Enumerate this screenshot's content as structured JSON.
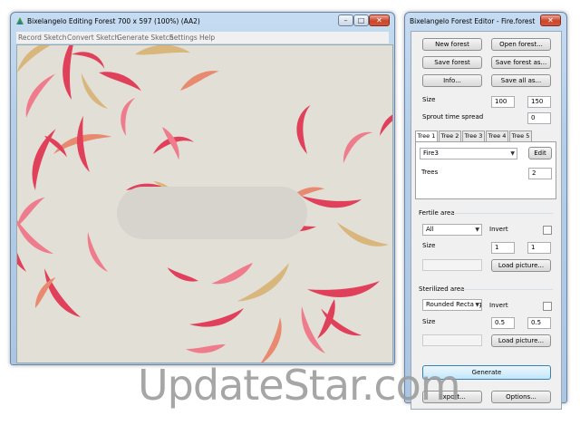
{
  "editing_window": {
    "title": "Bixelangelo Editing Forest 700 x 597 (100%) (AA2)",
    "menu": [
      "Record Sketch",
      "Convert Sketch",
      "Generate Sketch",
      "Settings",
      "Help"
    ],
    "controls": [
      "minimize",
      "maximize",
      "close"
    ]
  },
  "editor_window": {
    "title": "Bixelangelo Forest Editor - Fire.forest",
    "buttons": {
      "new_forest": "New forest",
      "open_forest": "Open forest...",
      "save_forest": "Save forest",
      "save_forest_as": "Save forest as...",
      "info": "Info...",
      "save_all_as": "Save all as..."
    },
    "size_label": "Size",
    "size_width": "100",
    "size_height": "150",
    "sprout_label": "Sprout time spread",
    "sprout_value": "0",
    "tabs": [
      "Tree 1",
      "Tree 2",
      "Tree 3",
      "Tree 4",
      "Tree 5"
    ],
    "tree_select": "Fire3",
    "edit_button": "Edit",
    "trees_label": "Trees",
    "trees_value": "2",
    "fertile": {
      "heading": "Fertile area",
      "mode": "All",
      "invert_label": "Invert",
      "size_label": "Size",
      "size_x": "1",
      "size_y": "1",
      "load_picture": "Load picture..."
    },
    "sterilized": {
      "heading": "Sterilized area",
      "mode": "Rounded Rectangle",
      "invert_label": "Invert",
      "size_label": "Size",
      "size_x": "0.5",
      "size_y": "0.5",
      "load_picture": "Load picture..."
    },
    "generate": "Generate",
    "export": "Export...",
    "options": "Options..."
  },
  "watermark": "UpdateStar.com",
  "colors": {
    "canvas_bg": "#e2dfd7",
    "leaf_red": "#e0405a",
    "leaf_pink": "#ef7c8c",
    "leaf_tan": "#d9b67c",
    "leaf_salmon": "#e88a70"
  }
}
